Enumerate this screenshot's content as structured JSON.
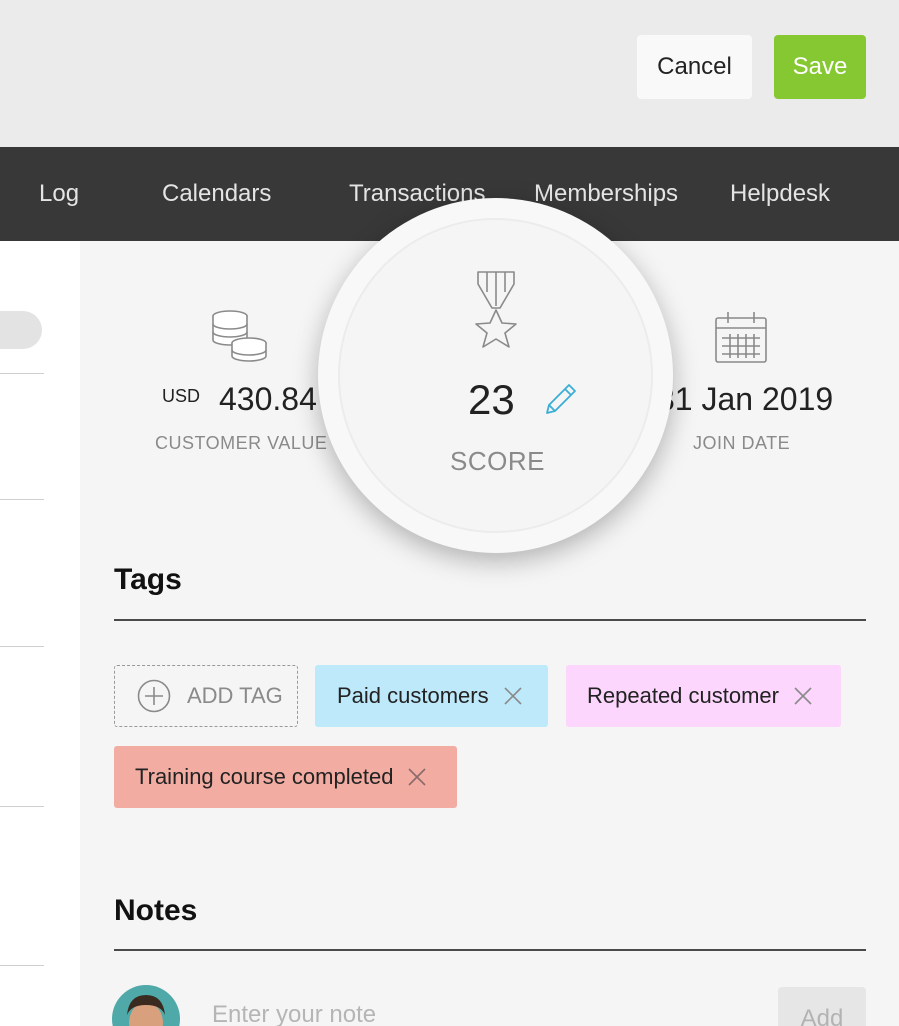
{
  "header": {
    "cancel_label": "Cancel",
    "save_label": "Save",
    "save_color": "#86c832"
  },
  "nav": {
    "items": [
      "Log",
      "Calendars",
      "Transactions",
      "Memberships",
      "Helpdesk"
    ]
  },
  "stats": {
    "customer_value": {
      "currency": "USD",
      "amount": "430.84",
      "label": "CUSTOMER VALUE",
      "icon": "coins-icon"
    },
    "score": {
      "value": "23",
      "label": "SCORE",
      "icon": "medal-icon",
      "edit_icon": "pencil-icon"
    },
    "join_date": {
      "value": "31 Jan 2019",
      "label": "JOIN DATE",
      "icon": "calendar-icon"
    }
  },
  "tags": {
    "title": "Tags",
    "add_label": "ADD TAG",
    "items": [
      {
        "label": "Paid customers",
        "color": "#bde9fb"
      },
      {
        "label": "Repeated customer",
        "color": "#fcd6fc"
      },
      {
        "label": "Training course completed",
        "color": "#f2aca2"
      }
    ]
  },
  "notes": {
    "title": "Notes",
    "placeholder": "Enter your note",
    "add_label": "Add"
  }
}
